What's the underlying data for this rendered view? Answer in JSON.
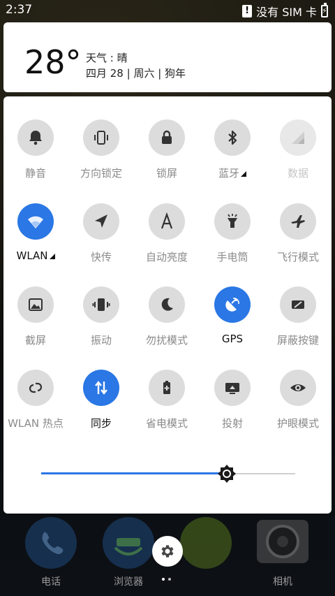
{
  "status_bar": {
    "time": "2:37",
    "sim_text": "没有 SIM 卡"
  },
  "weather": {
    "temperature": "28°",
    "condition": "天气 : 晴",
    "date_line": "四月 28 | 周六 | 狗年"
  },
  "tiles": [
    {
      "label": "静音",
      "icon": "bell-icon",
      "state": "off"
    },
    {
      "label": "方向锁定",
      "icon": "rotation-lock-icon",
      "state": "off"
    },
    {
      "label": "锁屏",
      "icon": "lock-icon",
      "state": "off"
    },
    {
      "label": "蓝牙",
      "icon": "bluetooth-icon",
      "state": "off",
      "expand": true
    },
    {
      "label": "数据",
      "icon": "signal-icon",
      "state": "disabled"
    },
    {
      "label": "WLAN",
      "icon": "wifi-icon",
      "state": "on",
      "expand": true
    },
    {
      "label": "快传",
      "icon": "send-icon",
      "state": "off"
    },
    {
      "label": "自动亮度",
      "icon": "auto-brightness-icon",
      "state": "off"
    },
    {
      "label": "手电筒",
      "icon": "flashlight-icon",
      "state": "off"
    },
    {
      "label": "飞行模式",
      "icon": "airplane-icon",
      "state": "off"
    },
    {
      "label": "截屏",
      "icon": "screenshot-icon",
      "state": "off"
    },
    {
      "label": "振动",
      "icon": "vibrate-icon",
      "state": "off"
    },
    {
      "label": "勿扰模式",
      "icon": "moon-icon",
      "state": "off"
    },
    {
      "label": "GPS",
      "icon": "gps-icon",
      "state": "on"
    },
    {
      "label": "屏蔽按键",
      "icon": "block-keys-icon",
      "state": "off"
    },
    {
      "label": "WLAN 热点",
      "icon": "hotspot-icon",
      "state": "off"
    },
    {
      "label": "同步",
      "icon": "sync-icon",
      "state": "on"
    },
    {
      "label": "省电模式",
      "icon": "battery-saver-icon",
      "state": "off"
    },
    {
      "label": "投射",
      "icon": "cast-icon",
      "state": "off"
    },
    {
      "label": "护眼模式",
      "icon": "eye-icon",
      "state": "off"
    }
  ],
  "brightness": {
    "level": 0.73,
    "icon": "brightness-icon"
  },
  "dock": [
    {
      "label": "电话",
      "icon": "phone-icon"
    },
    {
      "label": "浏览器",
      "icon": "browser-icon"
    },
    {
      "label": "",
      "icon": "messages-icon"
    },
    {
      "label": "相机",
      "icon": "camera-icon"
    }
  ],
  "settings_button": {
    "icon": "gear-icon"
  },
  "colors": {
    "accent": "#2a77e5",
    "tile_off": "#dcdcdc",
    "label_off": "#8a8a8a"
  }
}
